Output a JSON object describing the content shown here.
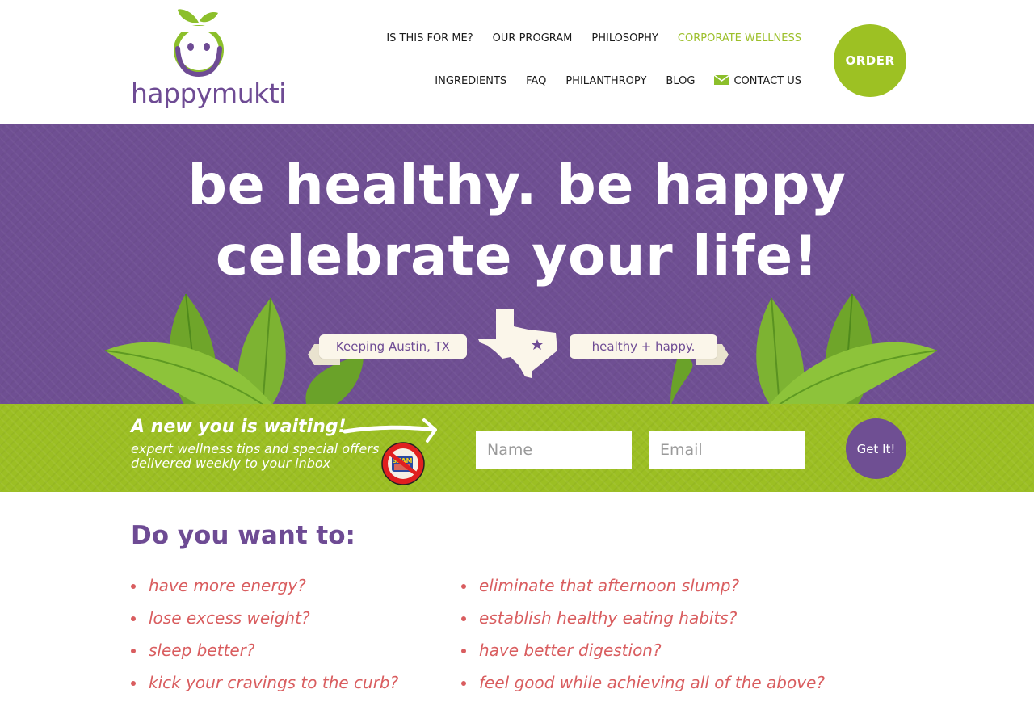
{
  "header": {
    "logo_text": "happymukti",
    "nav_top": [
      {
        "label": "IS THIS FOR ME?",
        "accent": false
      },
      {
        "label": "OUR PROGRAM",
        "accent": false
      },
      {
        "label": "PHILOSOPHY",
        "accent": false
      },
      {
        "label": "CORPORATE WELLNESS",
        "accent": true
      }
    ],
    "nav_bottom": [
      {
        "label": "INGREDIENTS"
      },
      {
        "label": "FAQ"
      },
      {
        "label": "PHILANTHROPY"
      },
      {
        "label": "BLOG"
      },
      {
        "label": "CONTACT US",
        "icon": "mail-icon"
      }
    ],
    "order_label": "ORDER"
  },
  "hero": {
    "line1": "be healthy. be happy",
    "line2": "celebrate your life!",
    "ribbon_left": "Keeping Austin, TX",
    "ribbon_right": "healthy + happy.",
    "map_icon": "texas-map-icon"
  },
  "signup": {
    "title": "A new you is waiting!",
    "subtitle_line1": "expert wellness tips and special offers",
    "subtitle_line2": "delivered weekly to your inbox",
    "name_placeholder": "Name",
    "email_placeholder": "Email",
    "submit_label": "Get It!",
    "nospam_badge_text": "SPAM"
  },
  "content": {
    "question": "Do you want to:",
    "left_items": [
      "have more energy?",
      "lose excess weight?",
      "sleep better?",
      "kick your cravings to the curb?"
    ],
    "right_items": [
      "eliminate that afternoon slump?",
      "establish healthy eating habits?",
      "have better digestion?",
      "feel good while achieving all of the above?"
    ]
  },
  "colors": {
    "brand_purple": "#6f4f93",
    "brand_green": "#9cbf23",
    "accent_red": "#d95d5f"
  }
}
